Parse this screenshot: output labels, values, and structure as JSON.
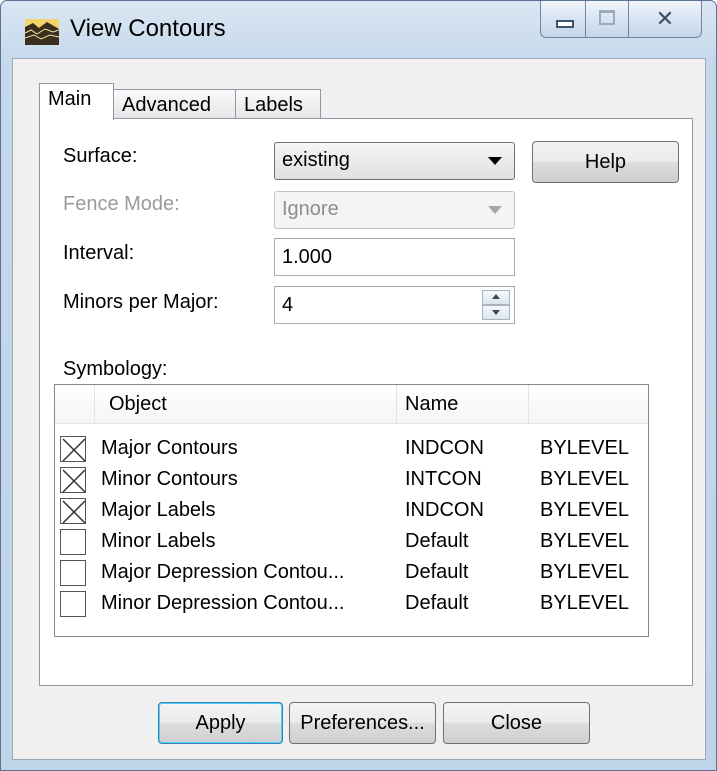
{
  "window": {
    "title": "View Contours"
  },
  "tabs": [
    {
      "label": "Main",
      "active": true
    },
    {
      "label": "Advanced",
      "active": false
    },
    {
      "label": "Labels",
      "active": false
    }
  ],
  "form": {
    "surface_label": "Surface:",
    "surface_value": "existing",
    "fence_label": "Fence Mode:",
    "fence_value": "Ignore",
    "interval_label": "Interval:",
    "interval_value": "1.000",
    "minors_label": "Minors per Major:",
    "minors_value": "4",
    "help_label": "Help"
  },
  "symbology": {
    "label": "Symbology:",
    "headers": [
      "Object",
      "Name",
      ""
    ],
    "rows": [
      {
        "checked": true,
        "object": "Major Contours",
        "name": "INDCON",
        "level": "BYLEVEL"
      },
      {
        "checked": true,
        "object": "Minor Contours",
        "name": "INTCON",
        "level": "BYLEVEL"
      },
      {
        "checked": true,
        "object": "Major Labels",
        "name": "INDCON",
        "level": "BYLEVEL"
      },
      {
        "checked": false,
        "object": "Minor Labels",
        "name": "Default",
        "level": "BYLEVEL"
      },
      {
        "checked": false,
        "object": "Major Depression Contou...",
        "name": "Default",
        "level": "BYLEVEL"
      },
      {
        "checked": false,
        "object": "Minor Depression Contou...",
        "name": "Default",
        "level": "BYLEVEL"
      }
    ]
  },
  "footer": {
    "apply_label": "Apply",
    "preferences_label": "Preferences...",
    "close_label": "Close"
  }
}
